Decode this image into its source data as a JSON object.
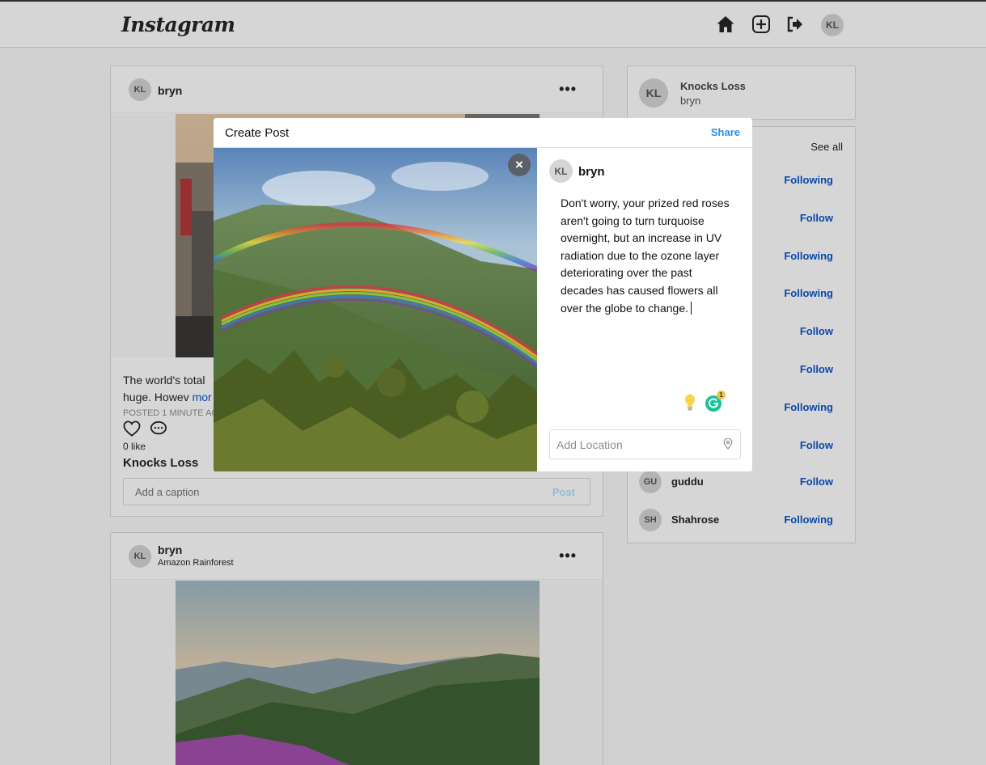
{
  "nav": {
    "logo": "Instagram",
    "avatar_initials": "KL"
  },
  "feed": {
    "post1": {
      "avatar": "KL",
      "username": "bryn",
      "caption_visible": "The world's total",
      "caption_line2": "huge. Howev",
      "more_link": "mor",
      "posted": "POSTED 1 MINUTE AG",
      "likes": "0 like",
      "commenter": "Knocks Loss",
      "comment_placeholder": "Add a caption",
      "post_button": "Post"
    },
    "post2": {
      "avatar": "KL",
      "username": "bryn",
      "location": "Amazon Rainforest"
    }
  },
  "sidebar": {
    "profile": {
      "avatar": "KL",
      "name": "Knocks Loss",
      "username": "bryn"
    },
    "see_all": "See all",
    "suggestions": [
      {
        "button": "Following"
      },
      {
        "button": "Follow"
      },
      {
        "button": "Following"
      },
      {
        "button": "Following"
      },
      {
        "button": "Follow"
      },
      {
        "button": "Follow"
      },
      {
        "button": "Following"
      },
      {
        "button": "Follow"
      },
      {
        "avatar": "GU",
        "name": "guddu",
        "button": "Follow"
      },
      {
        "avatar": "SH",
        "name": "Shahrose",
        "button": "Following"
      }
    ]
  },
  "modal": {
    "title": "Create Post",
    "share": "Share",
    "close": "×",
    "avatar": "KL",
    "username": "bryn",
    "caption": "Don't worry, your prized red roses aren't going to turn turquoise overnight, but an increase in UV radiation due to the ozone layer deteriorating over the past decades has caused flowers all over the globe to change.",
    "grammarly_badge": "1",
    "location_placeholder": "Add Location"
  },
  "colors": {
    "link_blue": "#0a58ca",
    "share_blue": "#2b8de0",
    "grammarly_green": "#15c39a"
  }
}
